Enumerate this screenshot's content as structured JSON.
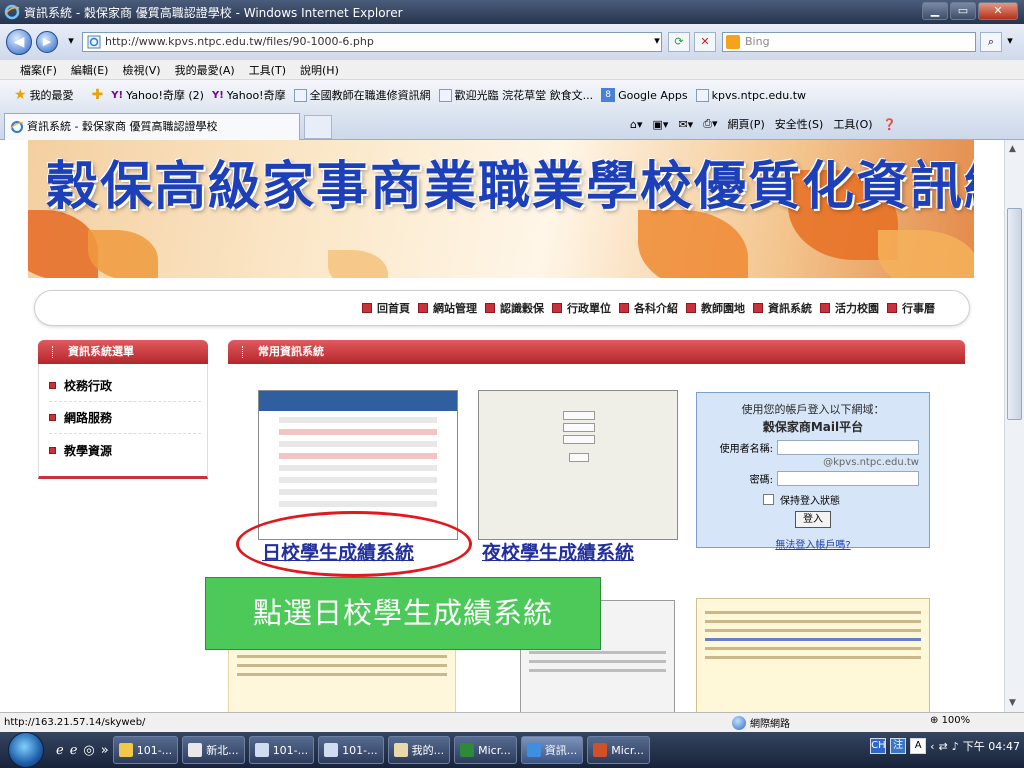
{
  "window": {
    "title": "資訊系統 - 穀保家商 優質高職認證學校 - Windows Internet Explorer",
    "buttons": {
      "minimize": "▁",
      "maximize": "▭",
      "close": "✕"
    }
  },
  "address": {
    "url": "http://www.kpvs.ntpc.edu.tw/files/90-1000-6.php",
    "search_placeholder": "Bing"
  },
  "menu": [
    "檔案(F)",
    "編輯(E)",
    "檢視(V)",
    "我的最愛(A)",
    "工具(T)",
    "說明(H)"
  ],
  "favorites": {
    "label": "我的最愛",
    "items": [
      "Yahoo!奇摩 (2)",
      "Yahoo!奇摩",
      "全國教師在職進修資訊網",
      "歡迎光臨 浣花草堂 飲食文...",
      "Google Apps",
      "kpvs.ntpc.edu.tw"
    ]
  },
  "tab": {
    "label": "資訊系統 - 穀保家商 優質高職認證學校"
  },
  "command_bar": [
    "網頁(P)",
    "安全性(S)",
    "工具(O)"
  ],
  "page": {
    "banner_title": "穀保高級家事商業職業學校優質化資訊網",
    "nav": [
      "回首頁",
      "網站管理",
      "認識穀保",
      "行政單位",
      "各科介紹",
      "教師園地",
      "資訊系統",
      "活力校園",
      "行事曆"
    ],
    "sidebar": {
      "title": "資訊系統選單",
      "items": [
        "校務行政",
        "網路服務",
        "教學資源"
      ]
    },
    "main_title": "常用資訊系統",
    "links": {
      "day": "日校學生成績系統",
      "night": "夜校學生成績系統"
    },
    "login": {
      "line1": "使用您的帳戶登入以下網域：",
      "line2": "穀保家商Mail平台",
      "user_label": "使用者名稱:",
      "domain": "@kpvs.ntpc.edu.tw",
      "password_label": "密碼:",
      "remember": "保持登入狀態",
      "submit": "登入",
      "help_link": "無法登入帳戶嗎?"
    },
    "callout": "點選日校學生成績系統"
  },
  "status": {
    "url": "http://163.21.57.14/skyweb/",
    "zone": "網際網路",
    "zoom": "100%"
  },
  "taskbar": {
    "items": [
      "101-...",
      "新北...",
      "101-...",
      "101-...",
      "我的...",
      "Micr...",
      "資訊...",
      "Micr..."
    ],
    "clock": "下午 04:47"
  }
}
